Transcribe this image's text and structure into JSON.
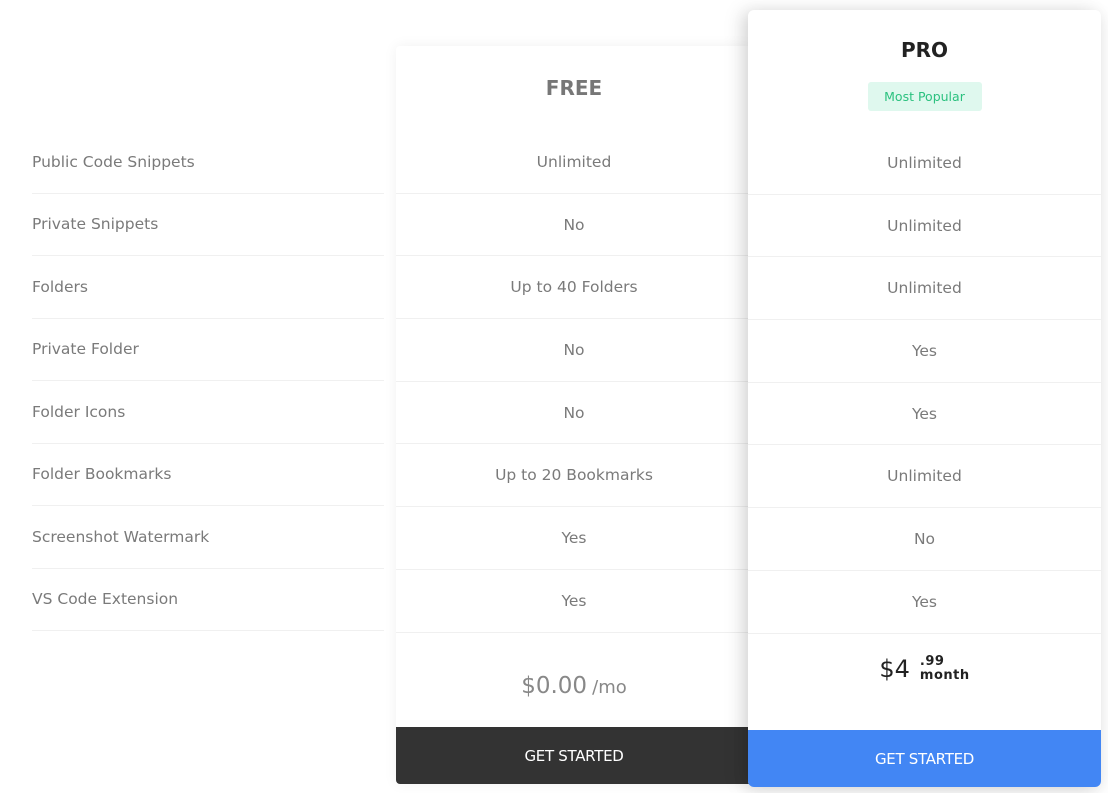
{
  "features": [
    "Public Code Snippets",
    "Private Snippets",
    "Folders",
    "Private Folder",
    "Folder Icons",
    "Folder Bookmarks",
    "Screenshot Watermark",
    "VS Code Extension"
  ],
  "plans": {
    "free": {
      "title": "FREE",
      "values": [
        "Unlimited",
        "No",
        "Up to 40 Folders",
        "No",
        "No",
        "Up to 20 Bookmarks",
        "Yes",
        "Yes"
      ],
      "price": "$0.00",
      "period": "/mo",
      "cta": "GET STARTED",
      "cta_color": "#333333"
    },
    "pro": {
      "title": "PRO",
      "badge": "Most Popular",
      "badge_color": "#2bc17f",
      "values": [
        "Unlimited",
        "Unlimited",
        "Unlimited",
        "Yes",
        "Yes",
        "Unlimited",
        "No",
        "Yes"
      ],
      "price_dollars": "$4",
      "price_cents": ".99",
      "period": "month",
      "cta": "GET STARTED",
      "cta_color": "#4286f4"
    }
  }
}
